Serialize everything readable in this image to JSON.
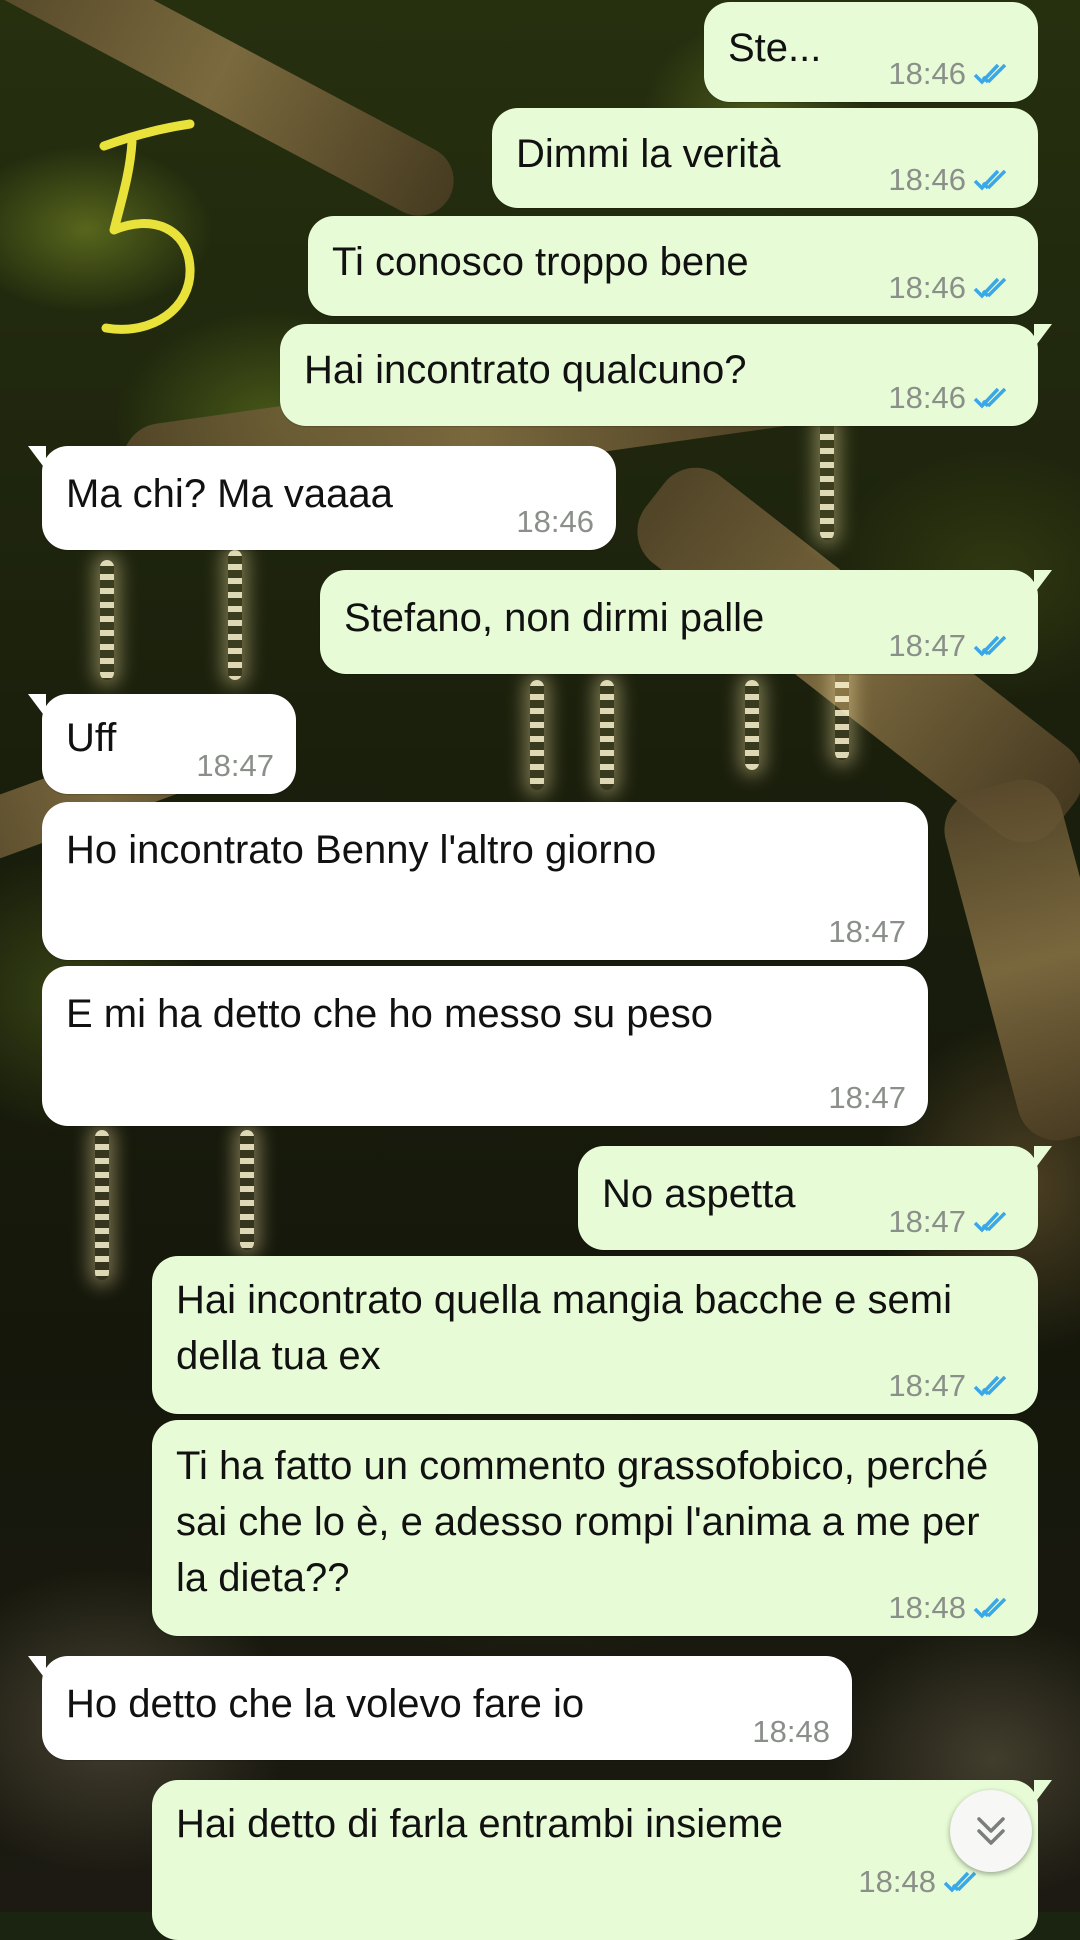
{
  "messages": [
    {
      "text": "Ste...",
      "time": "18:46",
      "dir": "out"
    },
    {
      "text": "Dimmi la verità",
      "time": "18:46",
      "dir": "out"
    },
    {
      "text": "Ti conosco troppo bene",
      "time": "18:46",
      "dir": "out"
    },
    {
      "text": "Hai incontrato qualcuno?",
      "time": "18:46",
      "dir": "out"
    },
    {
      "text": "Ma chi? Ma vaaaa",
      "time": "18:46",
      "dir": "in"
    },
    {
      "text": "Stefano, non dirmi palle",
      "time": "18:47",
      "dir": "out"
    },
    {
      "text": "Uff",
      "time": "18:47",
      "dir": "in"
    },
    {
      "text": "Ho incontrato Benny l'altro giorno",
      "time": "18:47",
      "dir": "in"
    },
    {
      "text": "E mi ha detto che ho messo su peso",
      "time": "18:47",
      "dir": "in"
    },
    {
      "text": "No aspetta",
      "time": "18:47",
      "dir": "out"
    },
    {
      "text": "Hai incontrato quella mangia bacche e semi della tua ex",
      "time": "18:47",
      "dir": "out"
    },
    {
      "text": "Ti ha fatto un commento grassofobico, perché sai che lo è, e adesso rompi l'anima a me per la dieta??",
      "time": "18:48",
      "dir": "out"
    },
    {
      "text": "Ho detto che la volevo fare io",
      "time": "18:48",
      "dir": "in"
    },
    {
      "text": "Hai detto di farla entrambi insieme",
      "time": "18:48",
      "dir": "out"
    }
  ],
  "read_tick_color": "#3aa7e8",
  "outgoing_bubble_color": "#e7fcd6",
  "incoming_bubble_color": "#ffffff",
  "scroll_button_icon": "double-chevron-down-icon"
}
